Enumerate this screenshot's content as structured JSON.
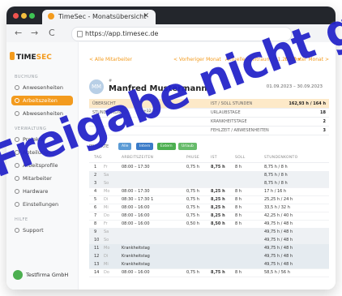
{
  "browser": {
    "tab_title": "TimeSec - Monatsübersicht",
    "tab_close": "✕",
    "back": "←",
    "forward": "→",
    "reload": "C",
    "url": "https://app.timesec.de"
  },
  "sidebar": {
    "logo_main": "TIME",
    "logo_accent": "SEC",
    "section_1": "BUCHUNG",
    "section_2": "VERWALTUNG",
    "section_3": "HILFE",
    "items": [
      {
        "label": "Anwesenheiten",
        "icon": "calendar-icon"
      },
      {
        "label": "Arbeitszeiten",
        "icon": "clock-icon"
      },
      {
        "label": "Abwesenheiten",
        "icon": "absence-icon"
      },
      {
        "label": "Projekte",
        "icon": "folder-icon"
      },
      {
        "label": "Abteilungen",
        "icon": "group-icon"
      },
      {
        "label": "Arbeitsprofile",
        "icon": "profile-icon"
      },
      {
        "label": "Mitarbeiter",
        "icon": "user-icon"
      },
      {
        "label": "Hardware",
        "icon": "device-icon"
      },
      {
        "label": "Einstellungen",
        "icon": "gear-icon"
      },
      {
        "label": "Support",
        "icon": "help-icon"
      }
    ],
    "company": "Testfirma GmbH"
  },
  "topnav": {
    "back": "< Alle Mitarbeiter",
    "prev": "< Vorheriger Monat",
    "current": "Aktueller Zeitraum (01.2023) ▾",
    "next": "Nächster Monat >"
  },
  "employee": {
    "initials": "MM",
    "prefix": "#",
    "name": "Manfred Mustermann",
    "range": "01.09.2023 – 30.09.2023"
  },
  "summary": {
    "rows": [
      {
        "a": "ÜBERSICHT",
        "b": "IST / SOLL STUNDEN",
        "v": "162,93 h / 164 h"
      },
      {
        "a": "STUNDENKONTO",
        "pill": "+12,8 h",
        "b": "URLAUBSTAGE",
        "v": "18"
      },
      {
        "a": "",
        "b": "KRANKHEITSTAGE",
        "v": "2"
      },
      {
        "a": "",
        "b": "FEHLZEIT / ABWESENHEITEN",
        "v": "3"
      }
    ]
  },
  "filters": {
    "label": "PROJEKTE",
    "chips": [
      "Alle",
      "Intern",
      "Extern",
      "Urlaub"
    ]
  },
  "table": {
    "headers": [
      "TAG",
      "",
      "ARBEITSZEITEN",
      "PAUSE",
      "IST",
      "SOLL",
      "STUNDENKONTO"
    ],
    "rows": [
      {
        "d": "1",
        "w": "Fr",
        "t": "08:00 – 17:30",
        "p": "0,75 h",
        "i": "8,75 h",
        "s": "8 h",
        "k": "8,75 h / 8 h",
        "type": "work"
      },
      {
        "d": "2",
        "w": "Sa",
        "t": "",
        "p": "",
        "i": "",
        "s": "",
        "k": "8,75 h / 8 h",
        "type": "we"
      },
      {
        "d": "3",
        "w": "So",
        "t": "",
        "p": "",
        "i": "",
        "s": "",
        "k": "8,75 h / 8 h",
        "type": "we"
      },
      {
        "d": "4",
        "w": "Mo",
        "t": "08:00 – 17:30",
        "p": "0,75 h",
        "i": "8,25 h",
        "s": "8 h",
        "k": "17 h / 16 h",
        "type": "work"
      },
      {
        "d": "5",
        "w": "Di",
        "t": "08:30 – 17:30 1",
        "p": "0,75 h",
        "i": "8,25 h",
        "s": "8 h",
        "k": "25,25 h / 24 h",
        "type": "work"
      },
      {
        "d": "6",
        "w": "Mi",
        "t": "08:00 – 16:00",
        "p": "0,75 h",
        "i": "8,25 h",
        "s": "8 h",
        "k": "33,5 h / 32 h",
        "type": "work"
      },
      {
        "d": "7",
        "w": "Do",
        "t": "08:00 – 16:00",
        "p": "0,75 h",
        "i": "8,25 h",
        "s": "8 h",
        "k": "42,25 h / 40 h",
        "type": "work"
      },
      {
        "d": "8",
        "w": "Fr",
        "t": "08:00 – 16:00",
        "p": "0,50 h",
        "i": "8,50 h",
        "s": "8 h",
        "k": "49,75 h / 48 h",
        "type": "work"
      },
      {
        "d": "9",
        "w": "Sa",
        "t": "",
        "p": "",
        "i": "",
        "s": "",
        "k": "49,75 h / 48 h",
        "type": "we"
      },
      {
        "d": "10",
        "w": "So",
        "t": "",
        "p": "",
        "i": "",
        "s": "",
        "k": "49,75 h / 48 h",
        "type": "we"
      },
      {
        "d": "11",
        "w": "Mo",
        "t": "Krankheitstag",
        "p": "",
        "i": "",
        "s": "",
        "k": "49,75 h / 48 h",
        "type": "hol"
      },
      {
        "d": "12",
        "w": "Di",
        "t": "Krankheitstag",
        "p": "",
        "i": "",
        "s": "",
        "k": "49,75 h / 48 h",
        "type": "hol"
      },
      {
        "d": "13",
        "w": "Mi",
        "t": "Krankheitstag",
        "p": "",
        "i": "",
        "s": "",
        "k": "49,75 h / 48 h",
        "type": "hol"
      },
      {
        "d": "14",
        "w": "Do",
        "t": "08:00 – 16:00",
        "p": "0,75 h",
        "i": "8,75 h",
        "s": "8 h",
        "k": "58,5 h / 56 h",
        "type": "work"
      }
    ]
  },
  "watermark": "Freigabe nicht ge",
  "colors": {
    "accent": "#f39b1e",
    "watermark": "#1e1ec8",
    "weekend": "#eef1f4"
  }
}
